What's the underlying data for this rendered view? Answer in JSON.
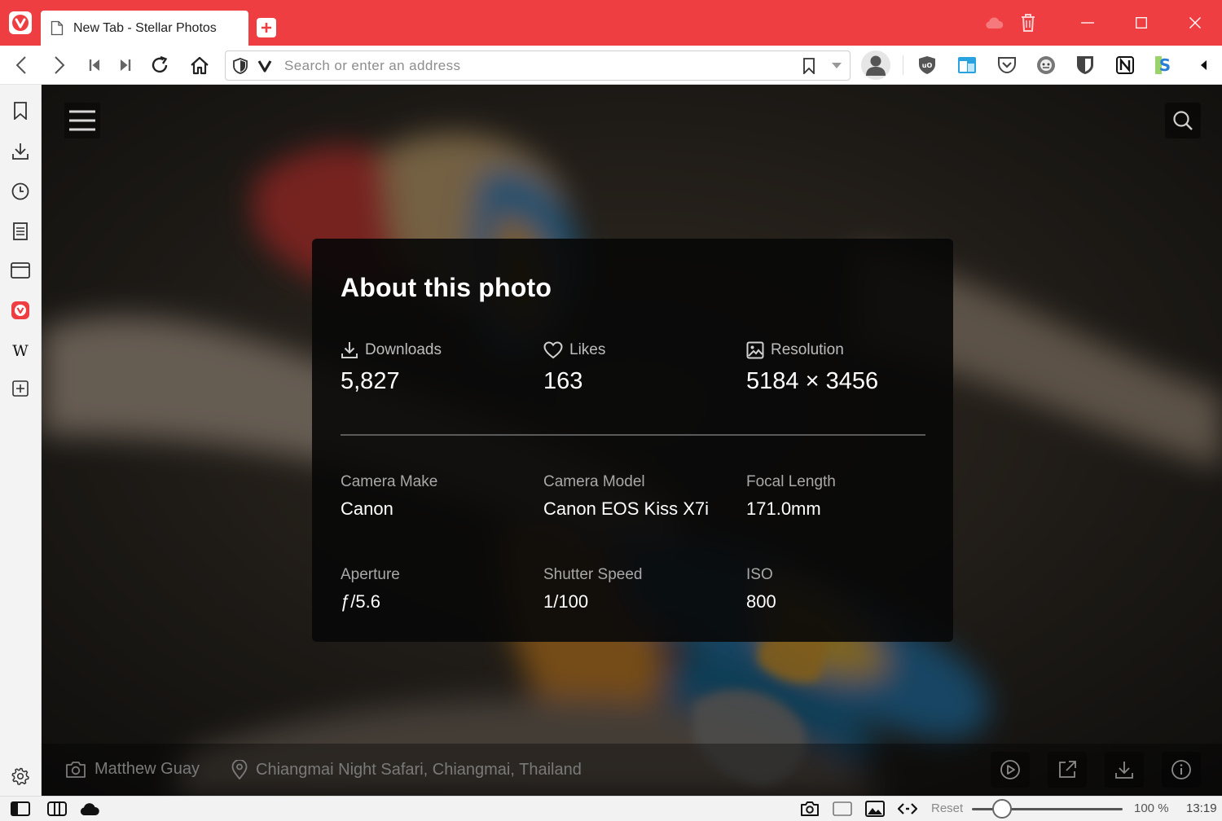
{
  "browser": {
    "tab_title": "New Tab - Stellar Photos",
    "address_placeholder": "Search or enter an address",
    "zoom_reset_label": "Reset",
    "zoom_level": "100 %",
    "zoom_fraction": 0.2,
    "clock": "13:19"
  },
  "page": {
    "panel_title": "About this photo",
    "stats": [
      {
        "label": "Downloads",
        "value": "5,827",
        "icon": "download-icon"
      },
      {
        "label": "Likes",
        "value": "163",
        "icon": "heart-icon"
      },
      {
        "label": "Resolution",
        "value": "5184 × 3456",
        "icon": "image-icon"
      }
    ],
    "exif": [
      {
        "label": "Camera Make",
        "value": "Canon"
      },
      {
        "label": "Camera Model",
        "value": "Canon EOS Kiss X7i"
      },
      {
        "label": "Focal Length",
        "value": "171.0mm"
      },
      {
        "label": "Aperture",
        "value": "ƒ/5.6"
      },
      {
        "label": "Shutter Speed",
        "value": "1/100"
      },
      {
        "label": "ISO",
        "value": "800"
      }
    ],
    "photographer": "Matthew Guay",
    "location": "Chiangmai Night Safari, Chiangmai, Thailand"
  },
  "colors": {
    "brand_red": "#ef3e42",
    "panel_bg": "#080808"
  }
}
